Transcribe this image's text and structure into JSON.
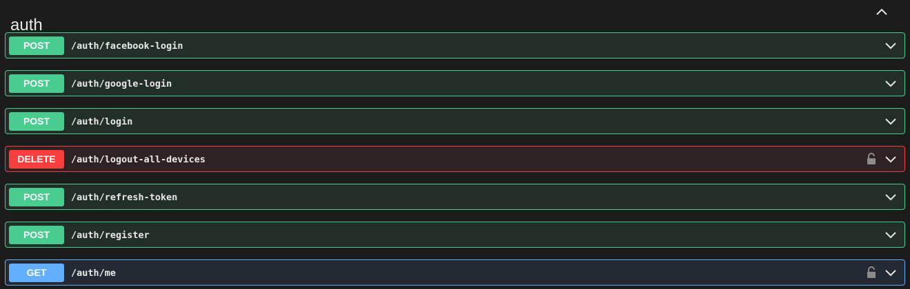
{
  "section": {
    "title": "auth",
    "toggle_icon": "chevron-up-icon"
  },
  "colors": {
    "post": "#49cc90",
    "delete": "#f93e3e",
    "get": "#61affe"
  },
  "operations": [
    {
      "method": "POST",
      "path": "/auth/facebook-login",
      "locked": false
    },
    {
      "method": "POST",
      "path": "/auth/google-login",
      "locked": false
    },
    {
      "method": "POST",
      "path": "/auth/login",
      "locked": false
    },
    {
      "method": "DELETE",
      "path": "/auth/logout-all-devices",
      "locked": true
    },
    {
      "method": "POST",
      "path": "/auth/refresh-token",
      "locked": false
    },
    {
      "method": "POST",
      "path": "/auth/register",
      "locked": false
    },
    {
      "method": "GET",
      "path": "/auth/me",
      "locked": true
    }
  ]
}
